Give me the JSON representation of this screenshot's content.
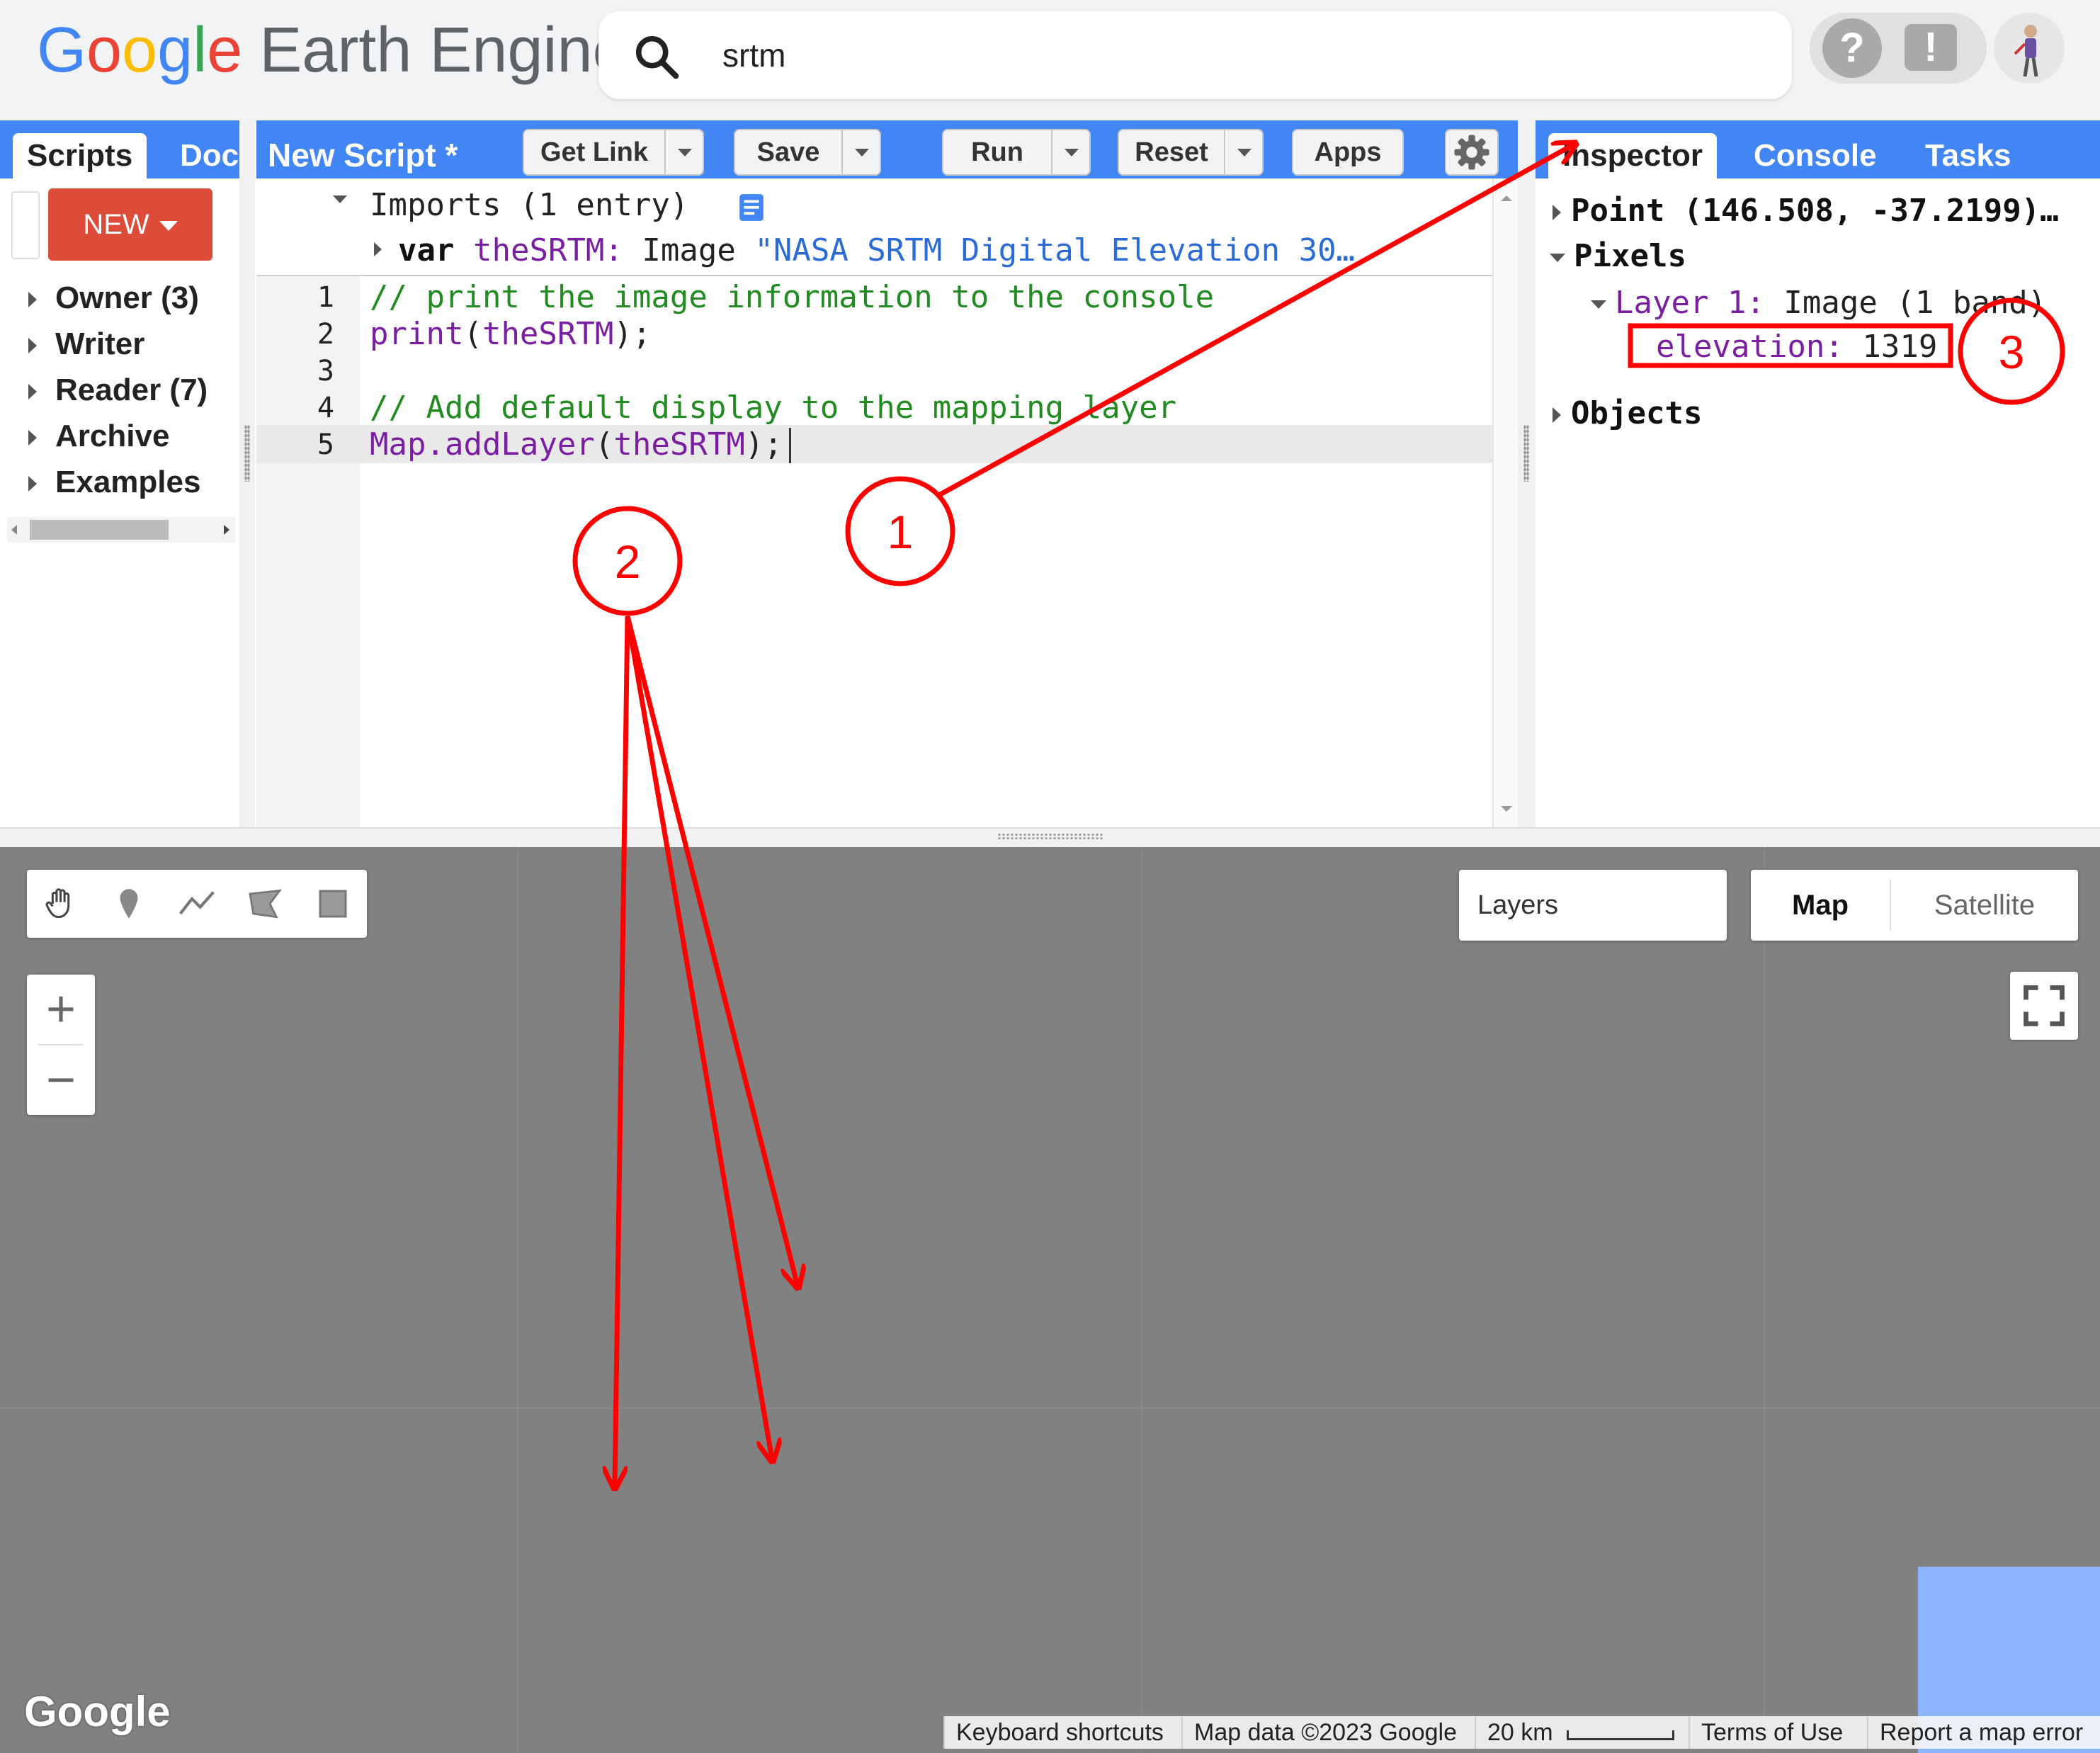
{
  "header": {
    "logo_google": "Google",
    "logo_product": "Earth Engine",
    "search_value": "srtm",
    "help_icon_glyph": "?",
    "feedback_icon_glyph": "!"
  },
  "left_panel": {
    "tabs": [
      {
        "label": "Scripts"
      },
      {
        "label": "Doc"
      }
    ],
    "new_button": "NEW",
    "tree": [
      {
        "label": "Owner (3)"
      },
      {
        "label": "Writer"
      },
      {
        "label": "Reader (7)"
      },
      {
        "label": "Archive"
      },
      {
        "label": "Examples"
      }
    ]
  },
  "editor": {
    "title": "New Script *",
    "buttons": {
      "get_link": "Get Link",
      "save": "Save",
      "run": "Run",
      "reset": "Reset",
      "apps": "Apps"
    },
    "imports": {
      "header": "Imports (1 entry)",
      "var_keyword": "var",
      "var_name": "theSRTM:",
      "var_type": "Image",
      "var_desc": "\"NASA SRTM Digital Elevation 30…"
    },
    "line_numbers": [
      "1",
      "2",
      "3",
      "4",
      "5"
    ],
    "lines": [
      {
        "comment": "// print the image information to the console"
      },
      {
        "fn": "print",
        "open": "(",
        "arg": "theSRTM",
        "close": ");"
      },
      {},
      {
        "comment": "// Add default display to the mapping layer"
      },
      {
        "fn": "Map.addLayer",
        "open": "(",
        "arg": "theSRTM",
        "close": ");"
      }
    ]
  },
  "right_panel": {
    "tabs": [
      {
        "label": "Inspector"
      },
      {
        "label": "Console"
      },
      {
        "label": "Tasks"
      }
    ],
    "point": "Point (146.508, -37.2199)…",
    "pixels": "Pixels",
    "layer_name": "Layer 1:",
    "layer_desc": "Image (1 band)",
    "band_name": "elevation:",
    "band_value": "1319",
    "objects": "Objects"
  },
  "map": {
    "layers_label": "Layers",
    "map_type_selected": "Map",
    "map_type_other": "Satellite",
    "zoom_in": "+",
    "zoom_out": "−",
    "google_logo": "Google",
    "footer": {
      "shortcuts": "Keyboard shortcuts",
      "map_data": "Map data ©2023 Google",
      "scale": "20 km",
      "terms": "Terms of Use",
      "report": "Report a map error"
    }
  },
  "annotations": {
    "circle_1": "1",
    "circle_2": "2",
    "circle_3": "3",
    "color": "#ff0000"
  },
  "colors": {
    "toolbar_blue": "#4285f4",
    "new_red": "#dd4b39",
    "map_gray": "#818181",
    "overlay_blue": "#8fb4ff"
  },
  "icons": [
    "search-icon",
    "help-icon",
    "feedback-icon",
    "avatar",
    "gear-icon",
    "hand-icon",
    "marker-icon",
    "line-icon",
    "polygon-icon",
    "rectangle-icon",
    "fullscreen-icon",
    "doc-icon"
  ]
}
